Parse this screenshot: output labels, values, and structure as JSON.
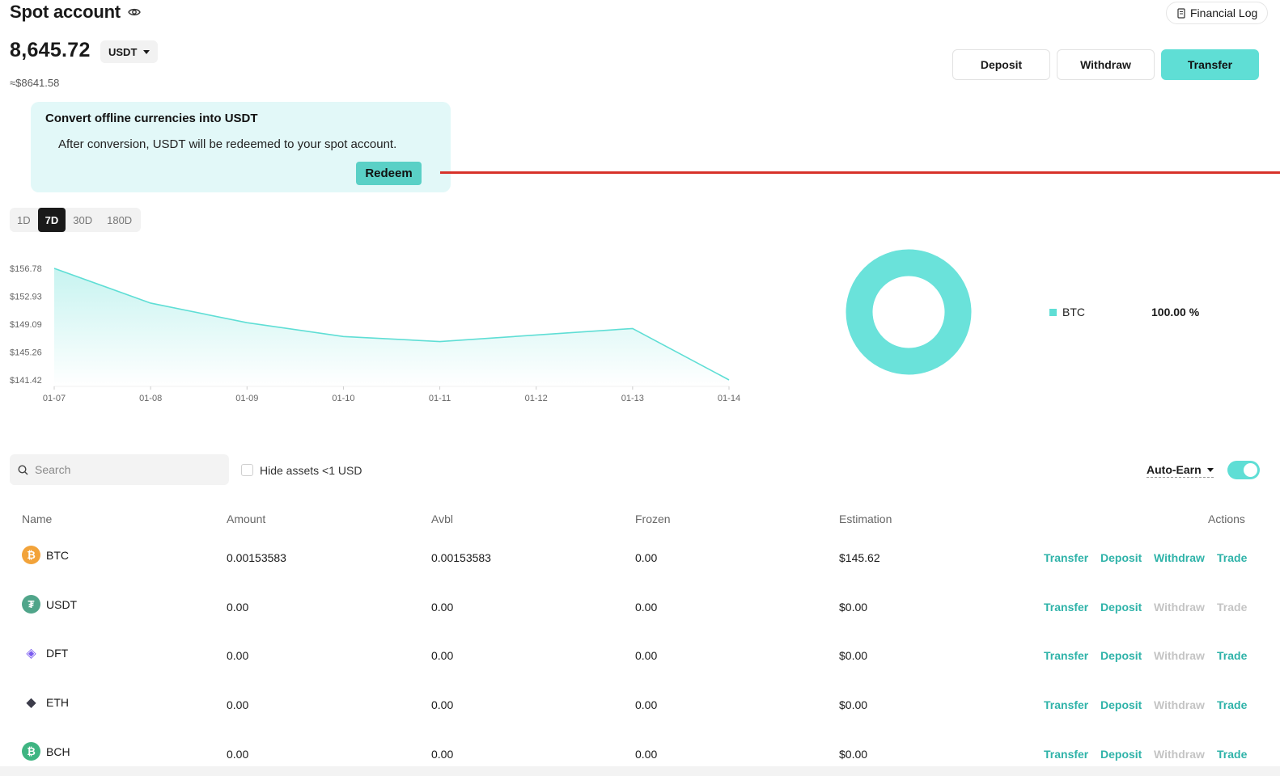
{
  "header": {
    "title": "Spot account",
    "financial_log": "Financial Log"
  },
  "balance": {
    "amount": "8,645.72",
    "currency": "USDT",
    "usd_estimate": "≈$8641.58"
  },
  "actions": {
    "deposit": "Deposit",
    "withdraw": "Withdraw",
    "transfer": "Transfer"
  },
  "promo": {
    "title": "Convert offline currencies into USDT",
    "body": "After conversion, USDT will be redeemed to your spot account.",
    "button": "Redeem"
  },
  "range_tabs": [
    {
      "label": "1D",
      "active": false
    },
    {
      "label": "7D",
      "active": true
    },
    {
      "label": "30D",
      "active": false
    },
    {
      "label": "180D",
      "active": false
    }
  ],
  "chart_data": {
    "type": "area",
    "x": [
      "01-07",
      "01-08",
      "01-09",
      "01-10",
      "01-11",
      "01-12",
      "01-13",
      "01-14"
    ],
    "values": [
      156.78,
      152.0,
      149.3,
      147.4,
      146.7,
      147.6,
      148.5,
      141.42
    ],
    "ytick_labels": [
      "$156.78",
      "$152.93",
      "$149.09",
      "$145.26",
      "$141.42"
    ],
    "ylim": [
      141.42,
      156.78
    ],
    "color": "#5fded5"
  },
  "allocation": {
    "chart_data": {
      "type": "pie",
      "categories": [
        "BTC"
      ],
      "values": [
        100.0
      ],
      "color": "#6ae2da"
    },
    "legend": [
      {
        "name": "BTC",
        "percent": "100.00 %"
      }
    ]
  },
  "filters": {
    "search_placeholder": "Search",
    "hide_small": "Hide assets <1 USD",
    "auto_earn": "Auto-Earn",
    "auto_earn_on": true
  },
  "table": {
    "headers": {
      "name": "Name",
      "amount": "Amount",
      "avbl": "Avbl",
      "frozen": "Frozen",
      "estimation": "Estimation",
      "actions": "Actions"
    },
    "action_labels": {
      "transfer": "Transfer",
      "deposit": "Deposit",
      "withdraw": "Withdraw",
      "trade": "Trade"
    },
    "rows": [
      {
        "coin": "BTC",
        "amount": "0.00153583",
        "avbl": "0.00153583",
        "frozen": "0.00",
        "estimation": "$145.62",
        "icon": "bitcoin-icon",
        "icon_color": "#f2a33a",
        "withdraw_enabled": true,
        "trade_enabled": true
      },
      {
        "coin": "USDT",
        "amount": "0.00",
        "avbl": "0.00",
        "frozen": "0.00",
        "estimation": "$0.00",
        "icon": "tether-icon",
        "icon_color": "#50a58a",
        "withdraw_enabled": false,
        "trade_enabled": false
      },
      {
        "coin": "DFT",
        "amount": "0.00",
        "avbl": "0.00",
        "frozen": "0.00",
        "estimation": "$0.00",
        "icon": "dft-icon",
        "icon_color": "#7b5cf0",
        "withdraw_enabled": false,
        "trade_enabled": true
      },
      {
        "coin": "ETH",
        "amount": "0.00",
        "avbl": "0.00",
        "frozen": "0.00",
        "estimation": "$0.00",
        "icon": "ethereum-icon",
        "icon_color": "#3c3c4a",
        "withdraw_enabled": false,
        "trade_enabled": true
      },
      {
        "coin": "BCH",
        "amount": "0.00",
        "avbl": "0.00",
        "frozen": "0.00",
        "estimation": "$0.00",
        "icon": "bitcoin-cash-icon",
        "icon_color": "#3fb582",
        "withdraw_enabled": false,
        "trade_enabled": true
      }
    ]
  }
}
